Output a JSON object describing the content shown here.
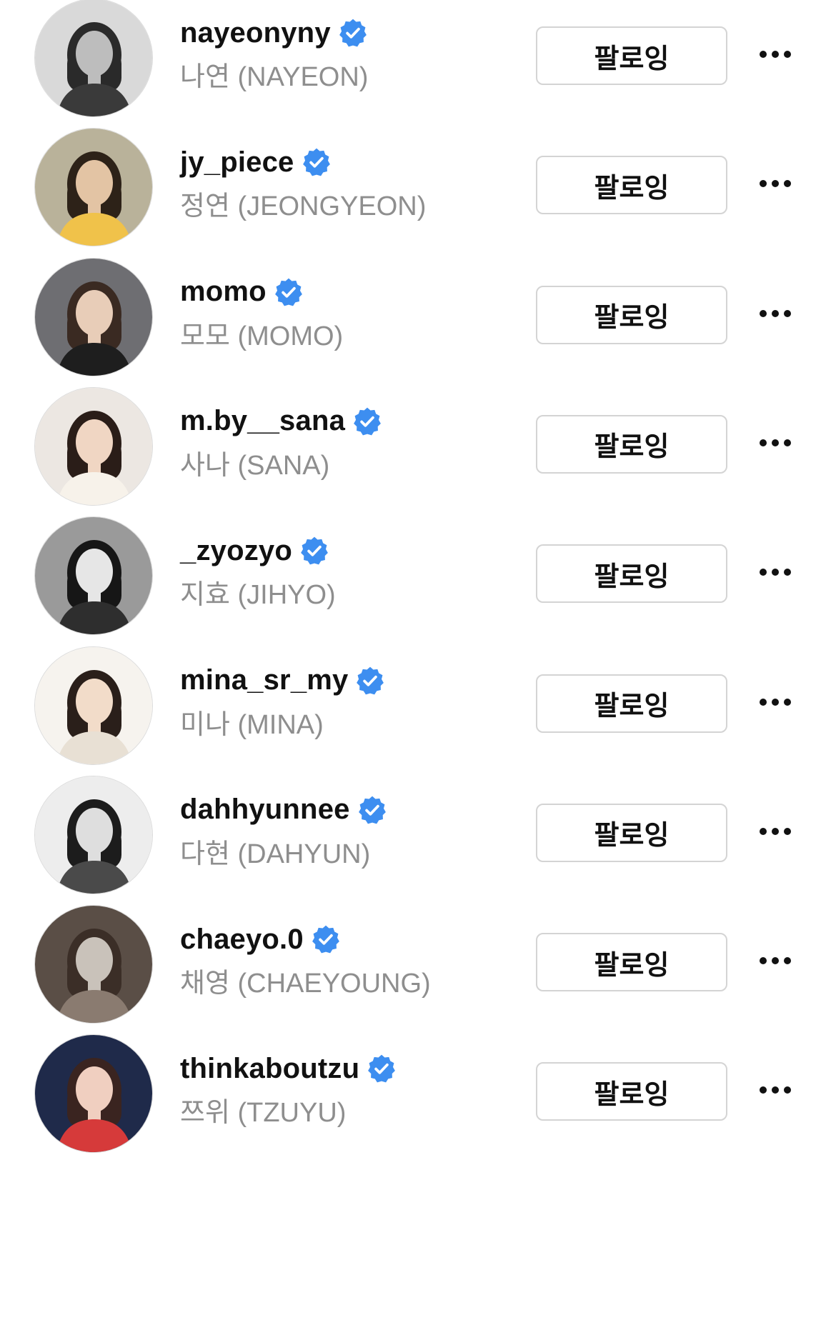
{
  "colors": {
    "verified": "#3d8ef0",
    "fullname": "#8e8e8e",
    "button_border": "#d4d4d4"
  },
  "icons": {
    "verified": "verified-badge-icon",
    "more": "more-horizontal-icon"
  },
  "follow_label": "팔로잉",
  "accounts": [
    {
      "username": "nayeonyny",
      "full_name": "나연 (NAYEON)",
      "verified": true,
      "button_label": "팔로잉",
      "avatar": {
        "bg": "#d9d9d9",
        "hair": "#2a2a2a",
        "skin": "#bdbdbd",
        "cloth": "#3a3a3a"
      }
    },
    {
      "username": "jy_piece",
      "full_name": "정연 (JEONGYEON)",
      "verified": true,
      "button_label": "팔로잉",
      "avatar": {
        "bg": "#b9b29a",
        "hair": "#2d2218",
        "skin": "#e3c4a4",
        "cloth": "#f0c24a"
      }
    },
    {
      "username": "momo",
      "full_name": "모모 (MOMO)",
      "verified": true,
      "button_label": "팔로잉",
      "avatar": {
        "bg": "#6e6e72",
        "hair": "#3a2a22",
        "skin": "#e8cdb8",
        "cloth": "#1e1e1e"
      }
    },
    {
      "username": "m.by__sana",
      "full_name": "사나 (SANA)",
      "verified": true,
      "button_label": "팔로잉",
      "avatar": {
        "bg": "#ece7e2",
        "hair": "#2a1d18",
        "skin": "#f0d6c3",
        "cloth": "#f7f2ea"
      }
    },
    {
      "username": "_zyozyo",
      "full_name": "지효 (JIHYO)",
      "verified": true,
      "button_label": "팔로잉",
      "avatar": {
        "bg": "#9a9a9a",
        "hair": "#161616",
        "skin": "#e6e6e6",
        "cloth": "#2e2e2e"
      }
    },
    {
      "username": "mina_sr_my",
      "full_name": "미나 (MINA)",
      "verified": true,
      "button_label": "팔로잉",
      "avatar": {
        "bg": "#f6f3ee",
        "hair": "#2a1f1a",
        "skin": "#f2dcc9",
        "cloth": "#e8e0d4"
      }
    },
    {
      "username": "dahhyunnee",
      "full_name": "다현 (DAHYUN)",
      "verified": true,
      "button_label": "팔로잉",
      "avatar": {
        "bg": "#ededed",
        "hair": "#1c1c1c",
        "skin": "#dedede",
        "cloth": "#4a4a4a"
      }
    },
    {
      "username": "chaeyo.0",
      "full_name": "채영 (CHAEYOUNG)",
      "verified": true,
      "button_label": "팔로잉",
      "avatar": {
        "bg": "#5a4e46",
        "hair": "#3b2e27",
        "skin": "#c9c2ba",
        "cloth": "#8a7b70"
      }
    },
    {
      "username": "thinkaboutzu",
      "full_name": "쯔위 (TZUYU)",
      "verified": true,
      "button_label": "팔로잉",
      "avatar": {
        "bg": "#1f2a4a",
        "hair": "#3a2420",
        "skin": "#f0cfc0",
        "cloth": "#d63a3a"
      }
    }
  ]
}
